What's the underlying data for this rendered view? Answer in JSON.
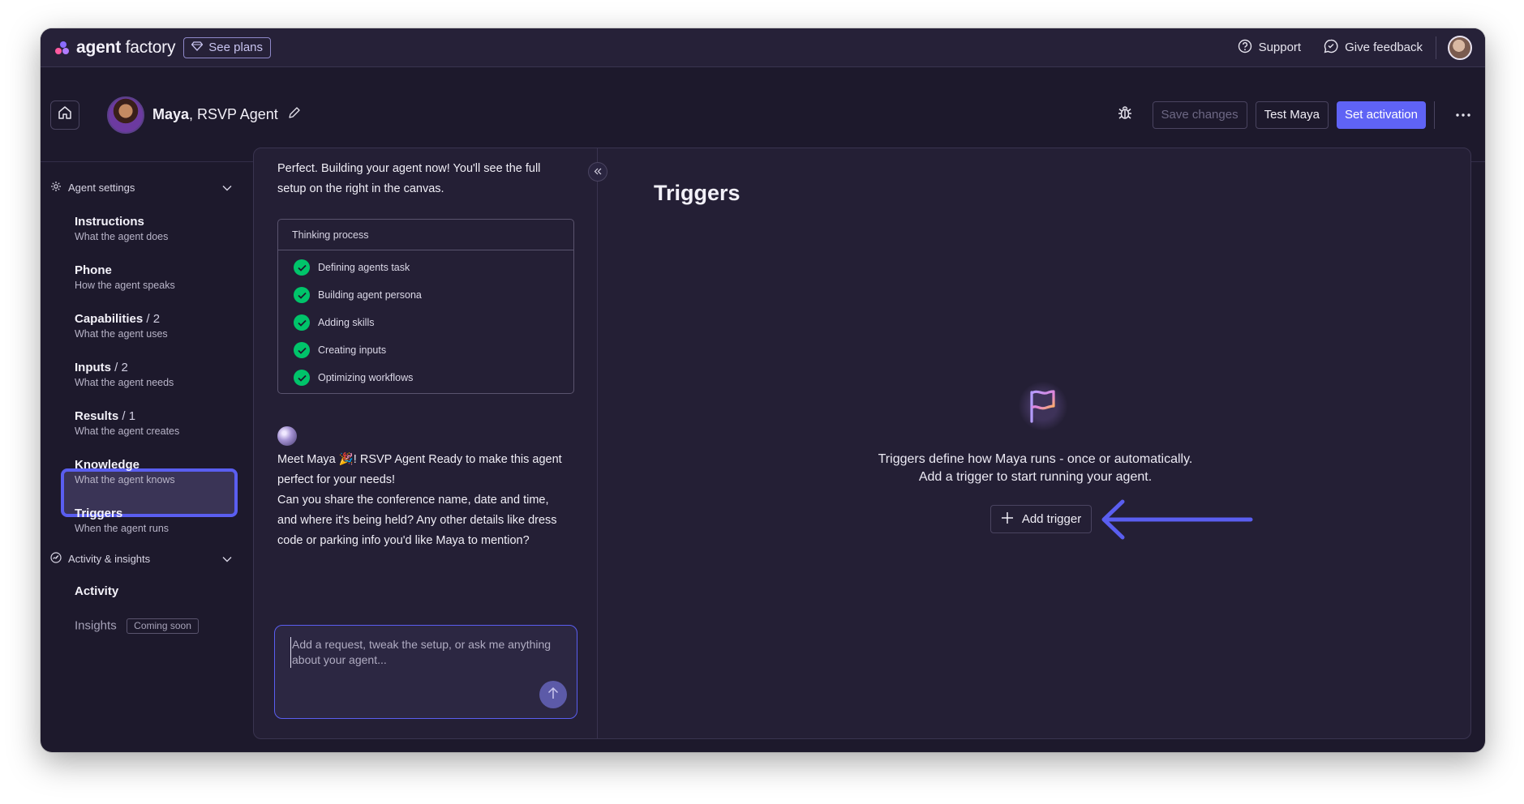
{
  "topbar": {
    "brand_bold": "agent",
    "brand_light": " factory",
    "plans_label": "See plans",
    "support_label": "Support",
    "feedback_label": "Give feedback"
  },
  "agent": {
    "name": "Maya",
    "role": ", RSVP Agent",
    "save_label": "Save changes",
    "test_label": "Test Maya",
    "activate_label": "Set activation"
  },
  "sidebar": {
    "settings_label": "Agent settings",
    "items": [
      {
        "title": "Instructions",
        "count": "",
        "sub": "What the agent does"
      },
      {
        "title": "Phone",
        "count": "",
        "sub": "How the agent speaks"
      },
      {
        "title": "Capabilities",
        "count": " / 2",
        "sub": "What the agent uses"
      },
      {
        "title": "Inputs",
        "count": " / 2",
        "sub": "What the agent needs"
      },
      {
        "title": "Results",
        "count": " / 1",
        "sub": "What the agent creates"
      },
      {
        "title": "Knowledge",
        "count": "",
        "sub": "What the agent knows"
      },
      {
        "title": "Triggers",
        "count": "",
        "sub": "When the agent runs"
      }
    ],
    "activity_section_label": "Activity & insights",
    "activity_label": "Activity",
    "insights_label": "Insights",
    "coming_soon": "Coming soon"
  },
  "chat": {
    "intro": "Perfect. Building your agent now! You'll see the full setup on the right in the canvas.",
    "thinking_label": "Thinking process",
    "steps": [
      "Defining agents task",
      "Building agent persona",
      "Adding skills",
      "Creating inputs",
      "Optimizing workflows"
    ],
    "meet_line": "Meet Maya 🎉! RSVP Agent Ready to make this agent perfect for your needs!",
    "question": "Can you share the conference name, date and time, and where it's being held? Any other details like dress code or parking info you'd like Maya to mention?",
    "composer_placeholder": "Add a request, tweak the setup, or ask me anything about your agent..."
  },
  "canvas": {
    "title": "Triggers",
    "empty_line1": "Triggers define how Maya runs - once or automatically.",
    "empty_line2": "Add a trigger to start running your agent.",
    "add_label": "Add trigger"
  },
  "colors": {
    "accent": "#5f63f5",
    "success": "#00c46a",
    "arrow": "#5a5ef0"
  }
}
